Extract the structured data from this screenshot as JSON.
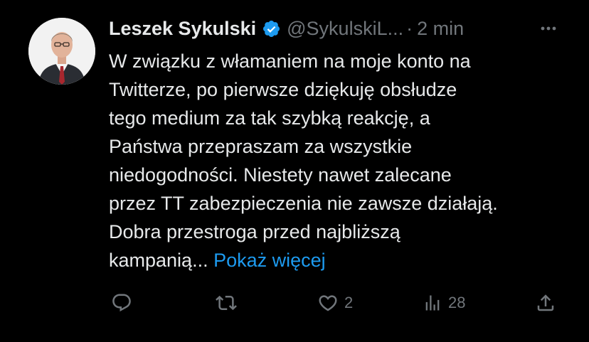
{
  "tweet": {
    "author": {
      "display_name": "Leszek Sykulski",
      "verified": true,
      "handle": "@SykulskiL...",
      "separator": "·",
      "time": "2 min"
    },
    "text_lines": [
      "W związku z włamaniem na moje konto na",
      "Twitterze, po pierwsze dziękuję obsłudze",
      "tego medium za tak szybką reakcję, a",
      "Państwa przepraszam za wszystkie",
      "niedogodności. Niestety nawet zalecane",
      "przez TT zabezpieczenia nie zawsze działają.",
      "Dobra przestroga przed najbliższą",
      "kampanią..."
    ],
    "show_more_label": "Pokaż więcej",
    "stats": {
      "replies": "",
      "reposts": "",
      "likes": "2",
      "views": "28"
    }
  },
  "icons": {
    "verified": "verified-badge-icon",
    "more": "more-horizontal-icon",
    "reply": "reply-icon",
    "repost": "repost-icon",
    "like": "heart-icon",
    "views": "views-chart-icon",
    "share": "share-icon"
  },
  "colors": {
    "background": "#000000",
    "text": "#e7e9ea",
    "secondary": "#71767b",
    "accent": "#1d9bf0"
  }
}
